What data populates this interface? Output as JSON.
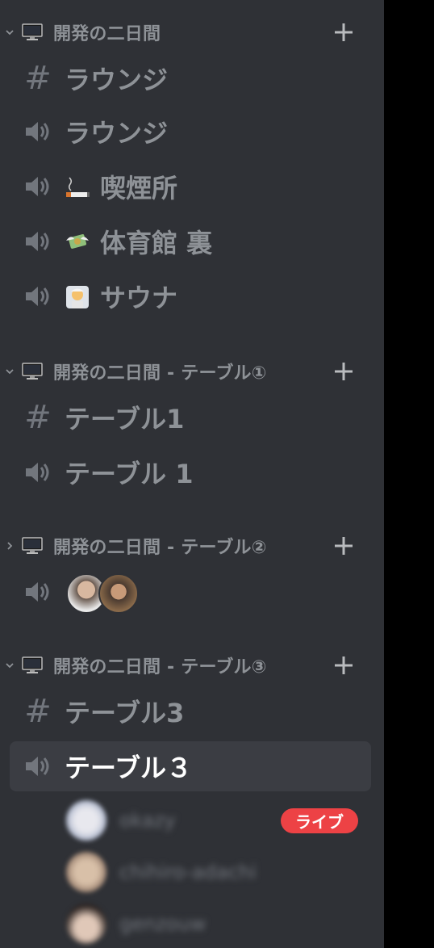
{
  "categories": [
    {
      "name": "開発の二日間",
      "expanded": true
    },
    {
      "name": "開発の二日間 - テーブル①",
      "expanded": true
    },
    {
      "name": "開発の二日間 - テーブル②",
      "expanded": false
    },
    {
      "name": "開発の二日間 - テーブル③",
      "expanded": true
    }
  ],
  "channels": {
    "c0_text_lounge": "ラウンジ",
    "c0_voice_lounge": "ラウンジ",
    "c0_voice_smoking": "喫煙所",
    "c0_voice_gym": "体育館 裏",
    "c0_voice_sauna": "サウナ",
    "c1_text_table1": "テーブル1",
    "c1_voice_table1": "テーブル 1",
    "c3_text_table3": "テーブル3",
    "c3_voice_table3": "テーブル３"
  },
  "voice_users": [
    {
      "name": "okazy",
      "live_badge": "ライブ"
    },
    {
      "name": "chihiro-adachi"
    },
    {
      "name": "genzouw"
    }
  ],
  "icons": {
    "category_toggle": "chevron-icon",
    "category_icon": "monitor-icon",
    "add": "plus-icon",
    "text_channel": "hash-icon",
    "voice_channel": "speaker-icon"
  },
  "colors": {
    "sidebar_bg": "#2f3136",
    "channel_text": "#8e9297",
    "active_bg": "#3b3d43",
    "live_badge": "#ed4245"
  }
}
